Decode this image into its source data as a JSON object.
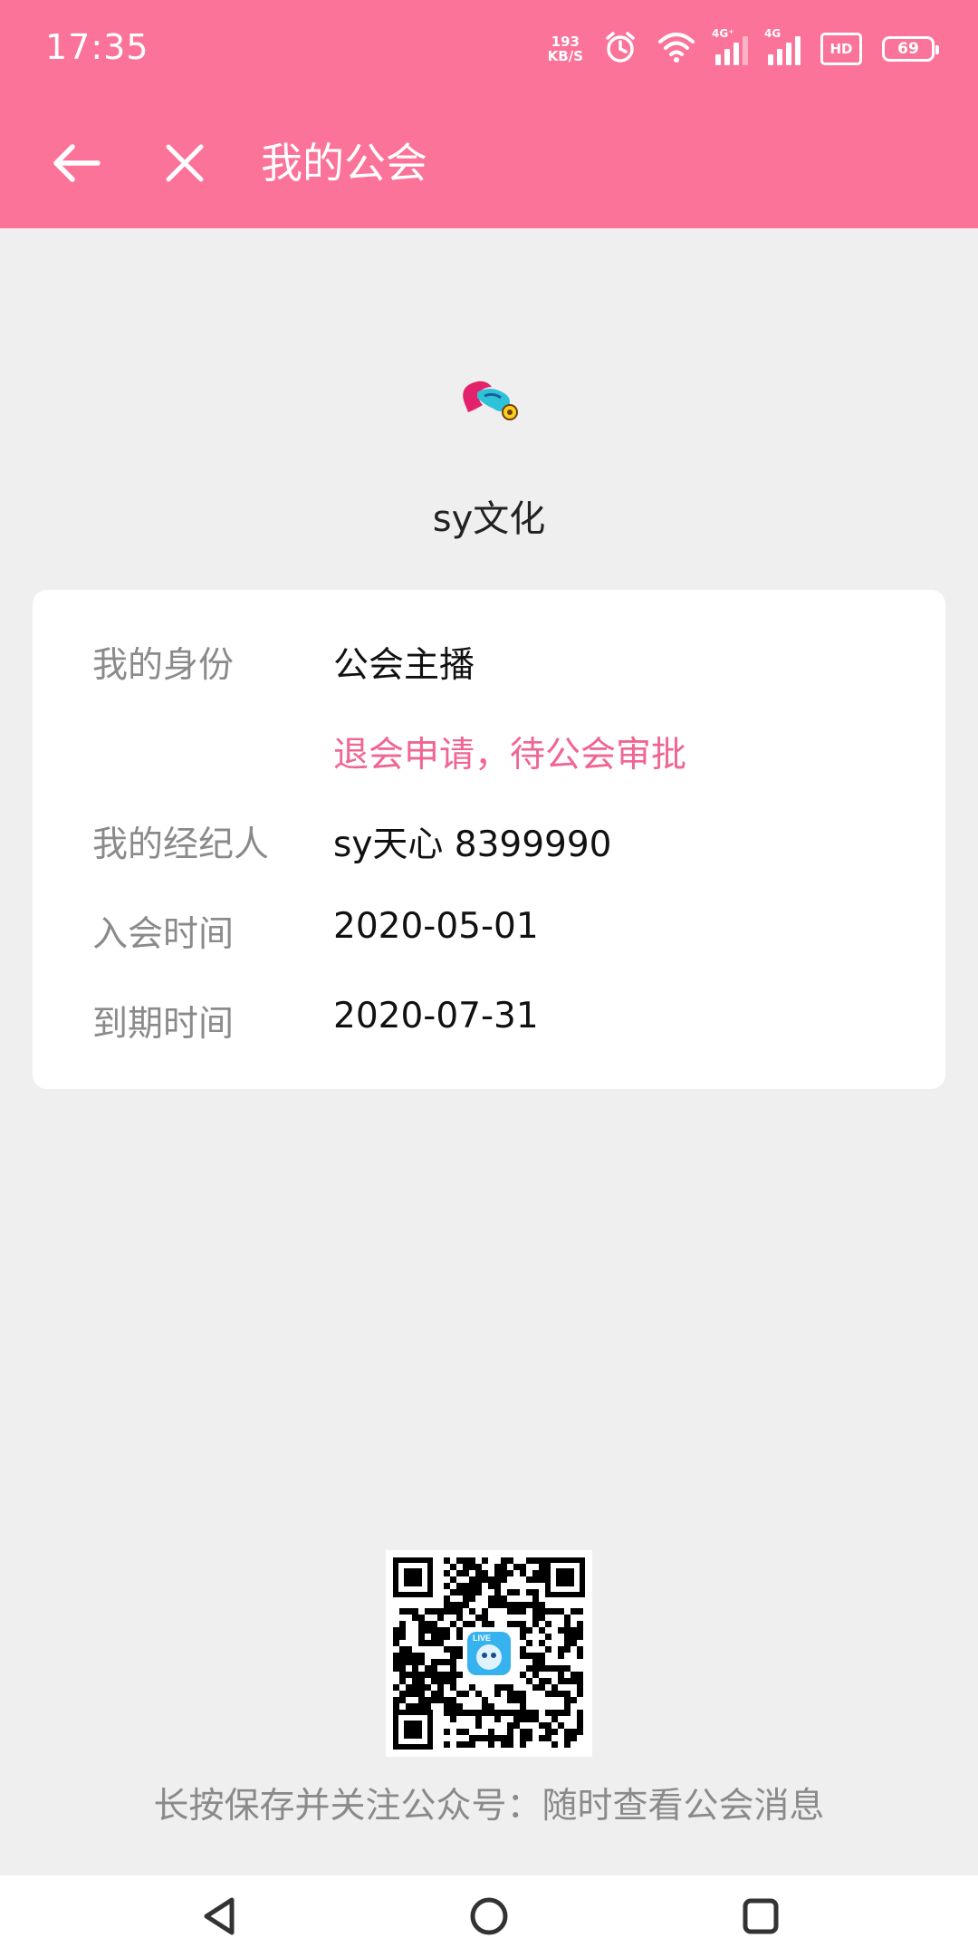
{
  "status_bar": {
    "time": "17:35",
    "net_speed_value": "193",
    "net_speed_unit": "KB/S",
    "signal1_tag": "4G⁺",
    "signal2_tag": "4G",
    "hd_label": "HD",
    "battery_level": "69"
  },
  "app_bar": {
    "title": "我的公会"
  },
  "guild": {
    "name": "sy文化"
  },
  "info": {
    "identity_label": "我的身份",
    "identity_value": "公会主播",
    "status_text": "退会申请，待公会审批",
    "agent_label": "我的经纪人",
    "agent_value": "sy天心 8399990",
    "join_label": "入会时间",
    "join_value": "2020-05-01",
    "expire_label": "到期时间",
    "expire_value": "2020-07-31"
  },
  "qr": {
    "center_badge": "LIVE",
    "caption": "长按保存并关注公众号：随时查看公会消息"
  },
  "colors": {
    "accent": "#fb7399",
    "status_pink": "#f06592",
    "background": "#efefef"
  },
  "icons": {
    "back": "arrow-left-icon",
    "close": "close-icon",
    "alarm": "alarm-icon",
    "wifi": "wifi-icon",
    "nav_back": "triangle-back-icon",
    "nav_home": "circle-home-icon",
    "nav_recent": "square-recent-icon"
  }
}
